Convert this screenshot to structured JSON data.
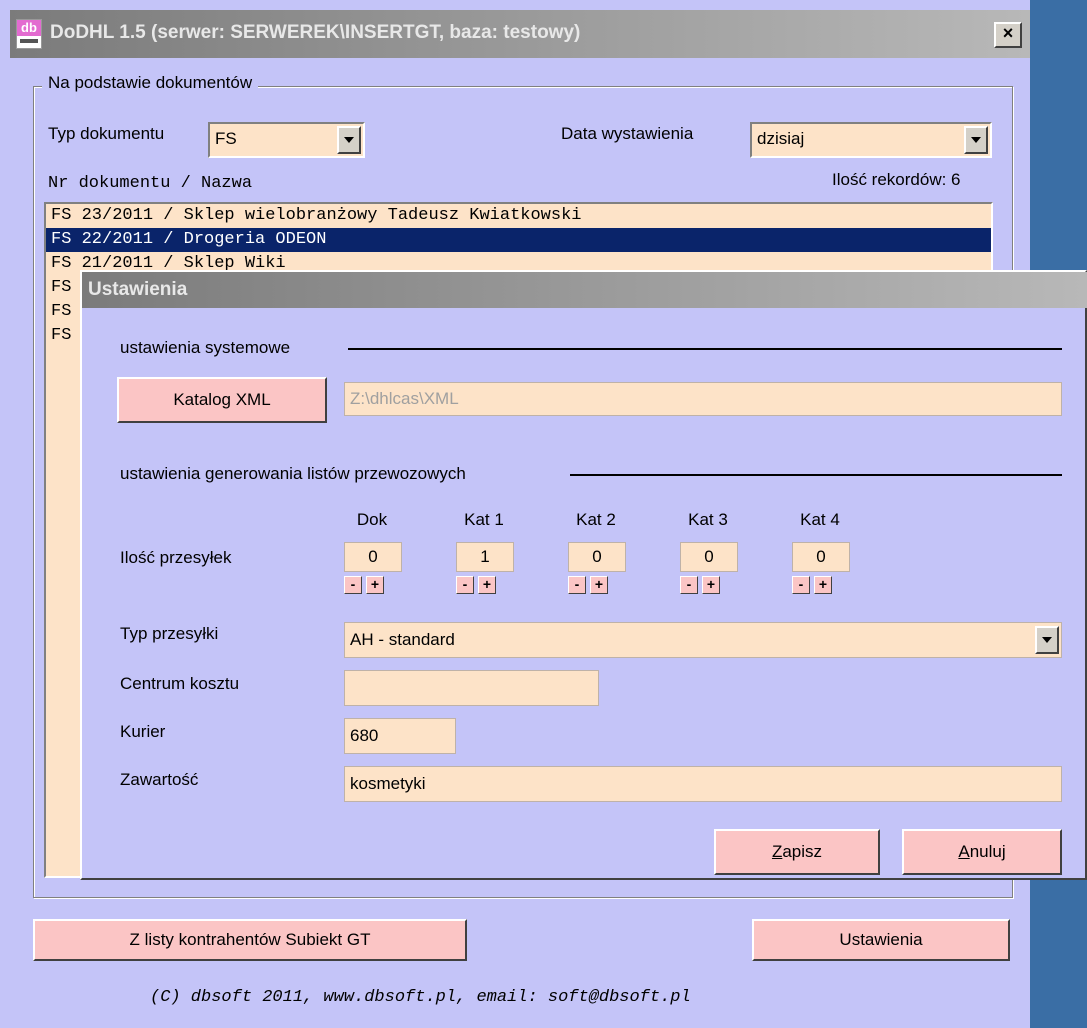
{
  "window": {
    "title": "DoDHL 1.5 (serwer: SERWEREK\\INSERTGT, baza: testowy)",
    "icon_text": "db",
    "close_glyph": "×"
  },
  "group_docs": {
    "legend": "Na podstawie dokumentów",
    "typ_label": "Typ dokumentu",
    "typ_value": "FS",
    "data_label": "Data wystawienia",
    "data_value": "dzisiaj",
    "list_header": "Nr dokumentu / Nazwa",
    "records_label": "Ilość rekordów: 6",
    "rows": [
      "FS 23/2011 / Sklep wielobranżowy Tadeusz Kwiatkowski",
      "FS 22/2011 / Drogeria ODEON",
      "FS 21/2011 / Sklep Wiki",
      "FS",
      "FS",
      "FS"
    ],
    "selected_row": 1
  },
  "bottom": {
    "contractors_button": "Z listy kontrahentów Subiekt GT",
    "settings_button": "Ustawienia",
    "footer": "(C) dbsoft 2011, www.dbsoft.pl, email: soft@dbsoft.pl"
  },
  "dialog": {
    "title": "Ustawienia",
    "section_system": "ustawienia systemowe",
    "xml_button": "Katalog XML",
    "xml_path": "Z:\\dhlcas\\XML",
    "section_generation": "ustawienia generowania listów przewozowych",
    "count_label": "Ilość przesyłek",
    "spinners": [
      {
        "label": "Dok",
        "value": "0"
      },
      {
        "label": "Kat 1",
        "value": "1"
      },
      {
        "label": "Kat 2",
        "value": "0"
      },
      {
        "label": "Kat 3",
        "value": "0"
      },
      {
        "label": "Kat 4",
        "value": "0"
      }
    ],
    "minus": "-",
    "plus": "+",
    "typ_label": "Typ przesyłki",
    "typ_value": "AH - standard",
    "centrum_label": "Centrum kosztu",
    "centrum_value": "",
    "kurier_label": "Kurier",
    "kurier_value": "680",
    "zawartosc_label": "Zawartość",
    "zawartosc_value": "kosmetyki",
    "save_first": "Z",
    "save_rest": "apisz",
    "cancel_first": "A",
    "cancel_rest": "nuluj"
  }
}
